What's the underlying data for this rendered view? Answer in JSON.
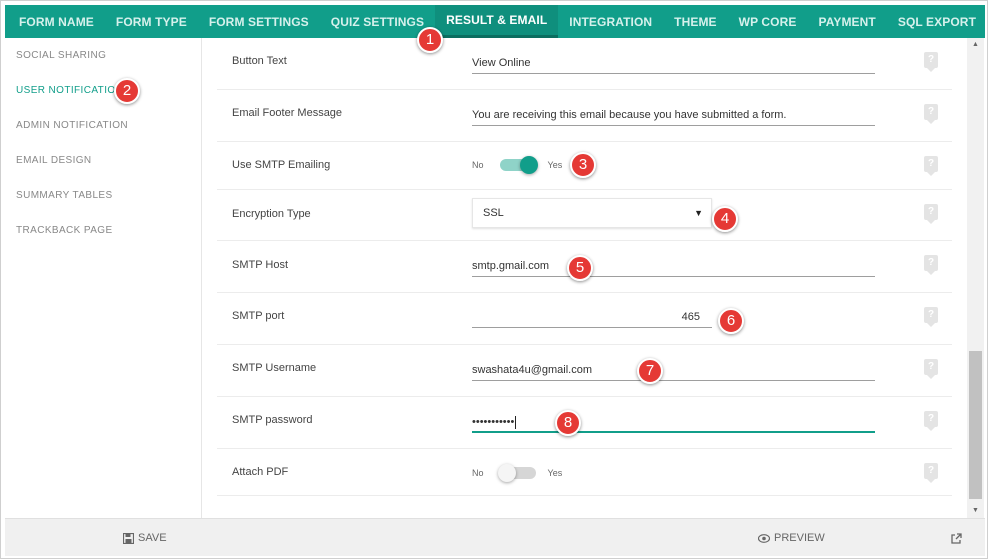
{
  "tabs": [
    {
      "label": "FORM NAME"
    },
    {
      "label": "FORM TYPE"
    },
    {
      "label": "FORM SETTINGS"
    },
    {
      "label": "QUIZ SETTINGS"
    },
    {
      "label": "RESULT & EMAIL",
      "active": true
    },
    {
      "label": "INTEGRATION"
    },
    {
      "label": "THEME"
    },
    {
      "label": "WP CORE"
    },
    {
      "label": "PAYMENT"
    },
    {
      "label": "SQL EXPORT"
    }
  ],
  "sidebar": {
    "items": [
      {
        "label": "SOCIAL SHARING"
      },
      {
        "label": "USER NOTIFICATION",
        "active": true
      },
      {
        "label": "ADMIN NOTIFICATION"
      },
      {
        "label": "EMAIL DESIGN"
      },
      {
        "label": "SUMMARY TABLES"
      },
      {
        "label": "TRACKBACK PAGE"
      }
    ]
  },
  "settings": {
    "button_text": {
      "label": "Button Text",
      "value": "View Online"
    },
    "email_footer": {
      "label": "Email Footer Message",
      "value": "You are receiving this email because you have submitted a form."
    },
    "use_smtp": {
      "label": "Use SMTP Emailing",
      "off_label": "No",
      "on_label": "Yes",
      "enabled": true
    },
    "encryption": {
      "label": "Encryption Type",
      "value": "SSL",
      "arrow": "▼"
    },
    "smtp_host": {
      "label": "SMTP Host",
      "value": "smtp.gmail.com"
    },
    "smtp_port": {
      "label": "SMTP port",
      "value": "465"
    },
    "smtp_username": {
      "label": "SMTP Username",
      "value": "swashata4u@gmail.com"
    },
    "smtp_password": {
      "label": "SMTP password",
      "value": "•••••••••••"
    },
    "attach_pdf": {
      "label": "Attach PDF",
      "off_label": "No",
      "on_label": "Yes",
      "enabled": false
    }
  },
  "help_icon_glyph": "?",
  "footer": {
    "save_label": "SAVE",
    "preview_label": "PREVIEW"
  },
  "callouts": [
    "1",
    "2",
    "3",
    "4",
    "5",
    "6",
    "7",
    "8"
  ],
  "colors": {
    "accent": "#119e8a",
    "callout": "#e53935"
  }
}
